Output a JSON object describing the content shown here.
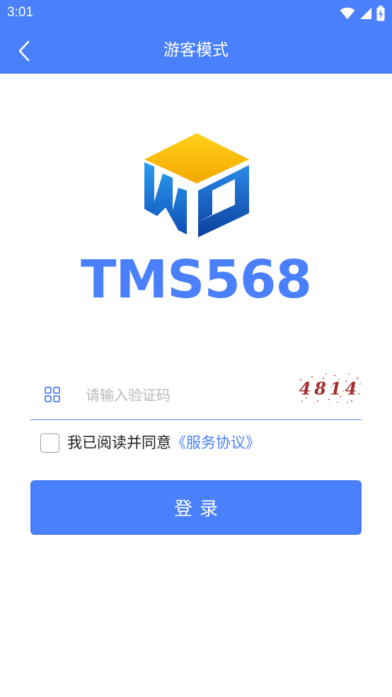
{
  "theme": {
    "primary": "#4a80fb",
    "logo_yellow": "#f6b700",
    "logo_blue": "#1a60c7"
  },
  "status_bar": {
    "time": "3:01",
    "icons": [
      "wifi-icon",
      "cellular-signal-icon",
      "battery-charging-icon"
    ]
  },
  "app_bar": {
    "back_icon": "chevron-left-icon",
    "title": "游客模式"
  },
  "logo": {
    "brand_name": "TMS568"
  },
  "verification": {
    "icon": "grid-icon",
    "placeholder": "请输入验证码",
    "value": "",
    "captcha_code": "4814"
  },
  "agreement": {
    "checked": false,
    "text": "我已阅读并同意",
    "link_text": "《服务协议》"
  },
  "login": {
    "label": "登录"
  }
}
